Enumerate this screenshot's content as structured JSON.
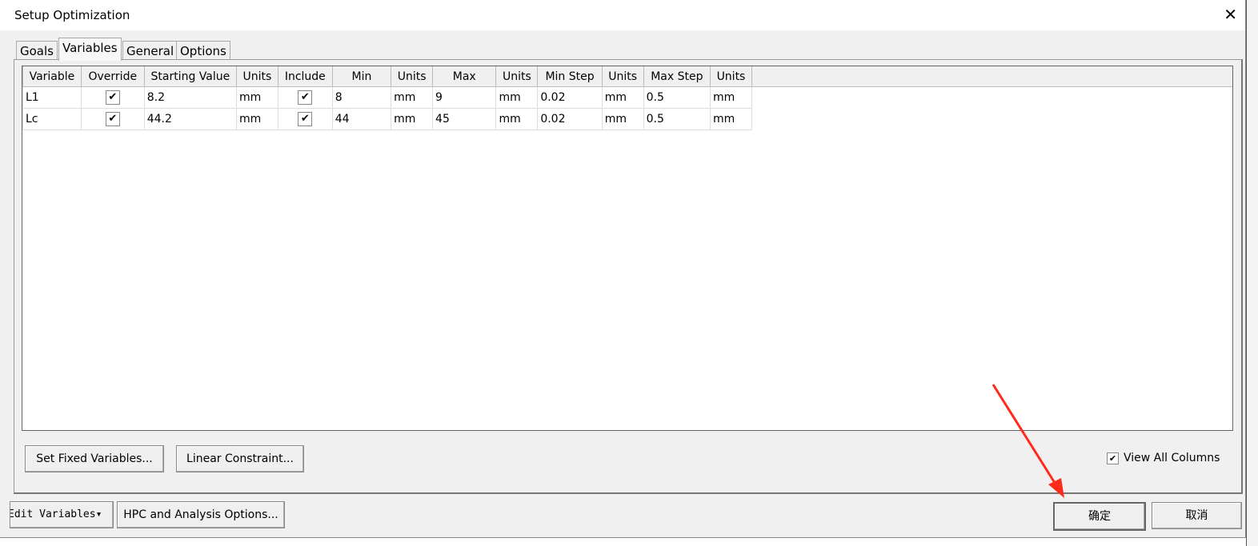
{
  "window": {
    "title": "Setup Optimization",
    "close": "✕"
  },
  "tabs": [
    {
      "label": "Goals"
    },
    {
      "label": "Variables"
    },
    {
      "label": "General"
    },
    {
      "label": "Options"
    }
  ],
  "table": {
    "headers": [
      "Variable",
      "Override",
      "Starting Value",
      "Units",
      "Include",
      "Min",
      "Units",
      "Max",
      "Units",
      "Min Step",
      "Units",
      "Max Step",
      "Units"
    ],
    "rows": [
      {
        "variable": "L1",
        "override": true,
        "start": "8.2",
        "u1": "mm",
        "include": true,
        "min": "8",
        "u2": "mm",
        "max": "9",
        "u3": "mm",
        "minstep": "0.02",
        "u4": "mm",
        "maxstep": "0.5",
        "u5": "mm"
      },
      {
        "variable": "Lc",
        "override": true,
        "start": "44.2",
        "u1": "mm",
        "include": true,
        "min": "44",
        "u2": "mm",
        "max": "45",
        "u3": "mm",
        "minstep": "0.02",
        "u4": "mm",
        "maxstep": "0.5",
        "u5": "mm"
      }
    ]
  },
  "buttons": {
    "set_fixed": "Set Fixed Variables...",
    "linear": "Linear Constraint...",
    "edit_vars": "Edit Variables",
    "hpc": "HPC and Analysis Options...",
    "ok": "确定",
    "cancel": "取消"
  },
  "view_all": {
    "label": "View All Columns",
    "checked": true
  },
  "check_glyph": "✔",
  "annotation_color": "#ff2a1a"
}
